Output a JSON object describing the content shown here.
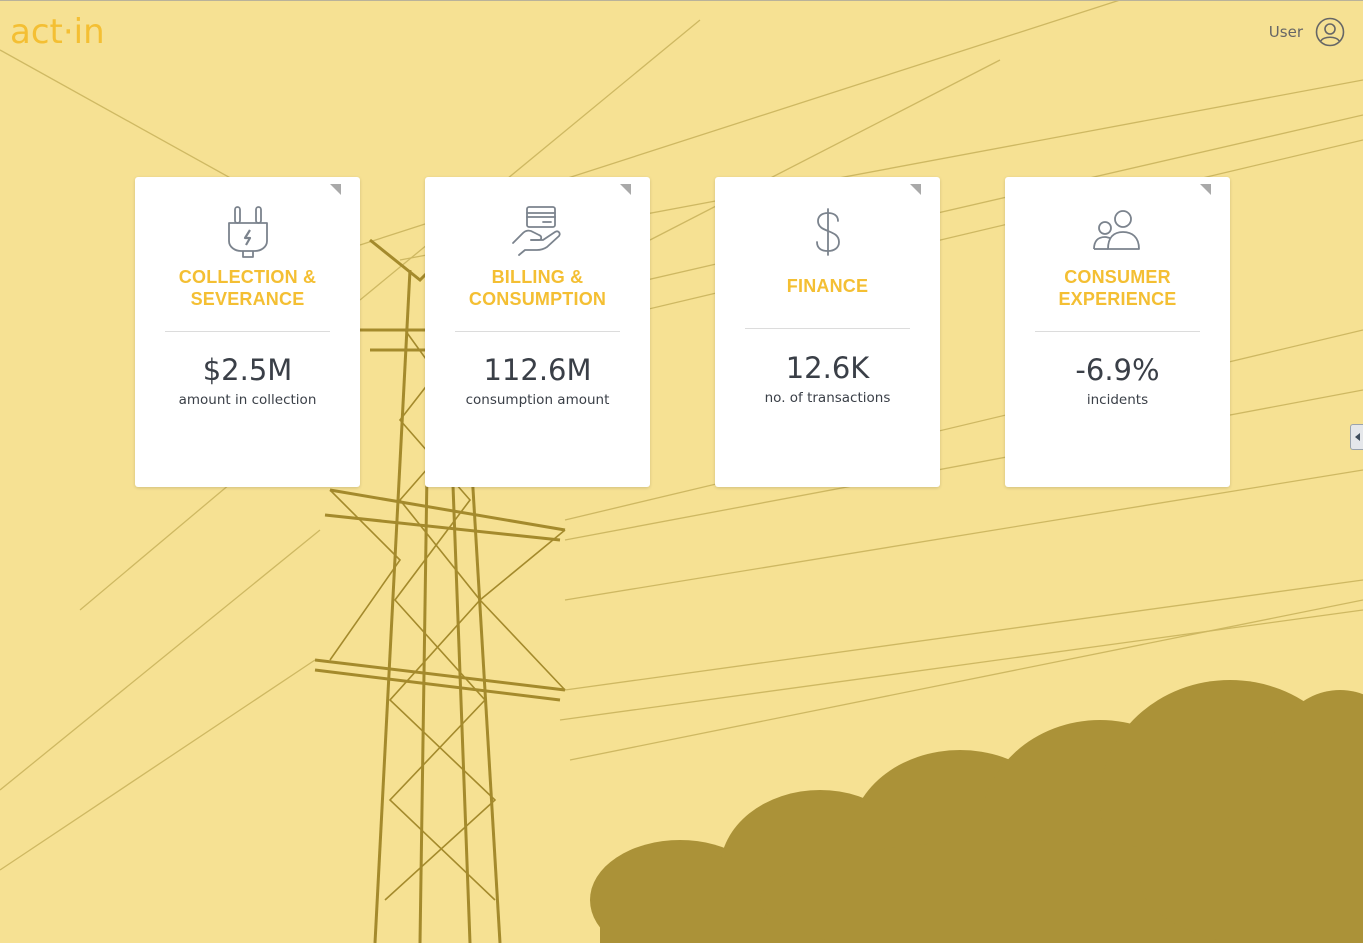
{
  "brand": {
    "logo_left": "act",
    "logo_dot": "·",
    "logo_right": "in",
    "color": "#f4bf33"
  },
  "header": {
    "user_label": "User",
    "user_icon": "user-circle-icon"
  },
  "cards": [
    {
      "icon": "plug-icon",
      "title_line1": "COLLECTION &",
      "title_line2": "SEVERANCE",
      "value": "$2.5M",
      "caption": "amount in collection"
    },
    {
      "icon": "card-in-hand-icon",
      "title_line1": "BILLING &",
      "title_line2": "CONSUMPTION",
      "value": "112.6M",
      "caption": "consumption amount"
    },
    {
      "icon": "dollar-icon",
      "title_line1": "FINANCE",
      "title_line2": "",
      "value": "12.6K",
      "caption": "no. of transactions"
    },
    {
      "icon": "users-icon",
      "title_line1": "CONSUMER",
      "title_line2": "EXPERIENCE",
      "value": "-6.9%",
      "caption": "incidents"
    }
  ],
  "colors": {
    "background": "#f6e193",
    "accent": "#f4bf33",
    "text": "#3a3f47",
    "icon": "#7b838d"
  },
  "side_panel": {
    "icon": "collapse-left-arrow-icon"
  }
}
